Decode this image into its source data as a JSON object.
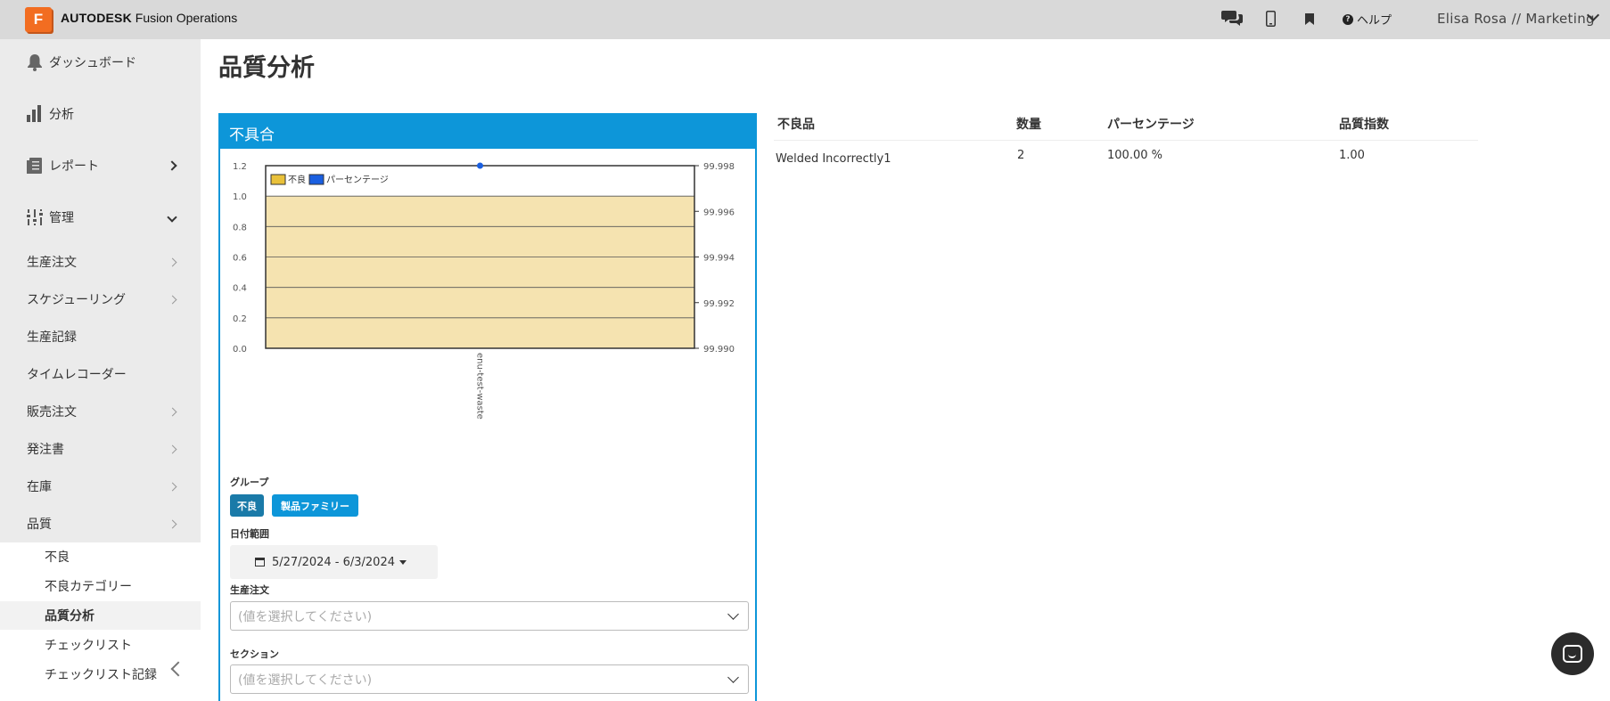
{
  "topbar": {
    "logo_letter": "F",
    "brand_bold": "AUTODESK",
    "brand_rest": " Fusion Operations",
    "help_label": "ヘルプ",
    "user_label": "Elisa Rosa // Marketing",
    "icons": [
      "chat-icon",
      "mobile-icon",
      "bookmark-icon",
      "help-icon",
      "chevron-down-icon"
    ]
  },
  "sidebar": {
    "items": [
      {
        "label": "ダッシュボード",
        "icon": "bell-icon"
      },
      {
        "label": "分析",
        "icon": "bar-chart-icon"
      },
      {
        "label": "レポート",
        "icon": "report-icon"
      },
      {
        "label": "管理",
        "icon": "sliders-icon"
      },
      {
        "label": "生産注文"
      },
      {
        "label": "スケジューリング"
      },
      {
        "label": "生産記録"
      },
      {
        "label": "タイムレコーダー"
      },
      {
        "label": "販売注文"
      },
      {
        "label": "発注書"
      },
      {
        "label": "在庫"
      },
      {
        "label": "品質"
      }
    ],
    "sub_items": [
      {
        "label": "不良"
      },
      {
        "label": "不良カテゴリー"
      },
      {
        "label": "品質分析"
      },
      {
        "label": "チェックリスト"
      },
      {
        "label": "チェックリスト記録"
      }
    ]
  },
  "main": {
    "title": "品質分析",
    "panel": {
      "title": "不具合",
      "group_label": "グループ",
      "group_buttons": [
        "不良",
        "製品ファミリー"
      ],
      "date_label": "日付範囲",
      "date_value": "5/27/2024 - 6/3/2024",
      "order_label": "生産注文",
      "order_placeholder": "(値を選択してください)",
      "section_label": "セクション",
      "section_placeholder": "(値を選択してください)"
    },
    "table": {
      "headers": [
        "不良品",
        "数量",
        "パーセンテージ",
        "品質指数"
      ],
      "rows": [
        [
          "Welded Incorrectly1",
          "2",
          "100.00 %",
          "1.00"
        ]
      ]
    }
  },
  "chart_data": {
    "type": "bar",
    "categories": [
      "enu-test-waste"
    ],
    "series": [
      {
        "name": "不良",
        "values": [
          1.0
        ],
        "color": "#f5e3b0",
        "axis": "left"
      },
      {
        "name": "パーセンテージ",
        "values": [
          100.0
        ],
        "color": "#1a5fe0",
        "axis": "right"
      }
    ],
    "y_left": {
      "ticks": [
        "1.2",
        "1.0",
        "0.8",
        "0.6",
        "0.4",
        "0.2",
        "0.0"
      ],
      "ylim": [
        0,
        1.2
      ]
    },
    "y_right": {
      "ticks": [
        "99.998",
        "99.996",
        "99.994",
        "99.992",
        "99.990"
      ],
      "ylim": [
        99.99,
        99.998
      ]
    },
    "legend": "top-left",
    "grid": true
  }
}
